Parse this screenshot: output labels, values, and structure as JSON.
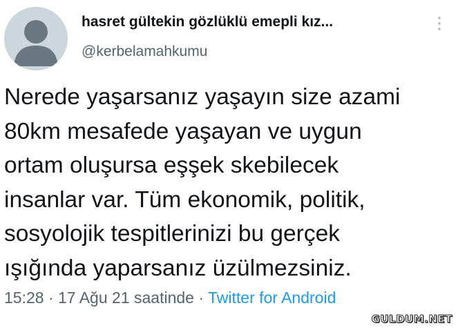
{
  "author": {
    "display_name": "hasret gültekin gözlüklü emepli kız...",
    "handle": "@kerbelamahkumu"
  },
  "tweet": {
    "lines": [
      "Nerede yaşarsanız yaşayın size azami",
      "80km mesafede yaşayan ve uygun",
      "ortam oluşursa eşşek skebilecek",
      "insanlar var. Tüm ekonomik, politik,",
      "sosyolojik tespitlerinizi bu gerçek",
      "ışığında yaparsanız üzülmezsiniz."
    ]
  },
  "meta": {
    "time": "15:28",
    "separator_1": " · ",
    "date": "17 Ağu 21 saatinde",
    "separator_2": " · ",
    "source": "Twitter for Android"
  },
  "watermark": "GULDUM.NET",
  "colors": {
    "text": "#0f1419",
    "secondary": "#536471",
    "link": "#1d9bf0",
    "avatar_bg": "#ccd6dd",
    "avatar_fg": "#6b7780"
  },
  "icons": {
    "avatar": "default-avatar-icon",
    "more": "more-vertical-icon"
  }
}
